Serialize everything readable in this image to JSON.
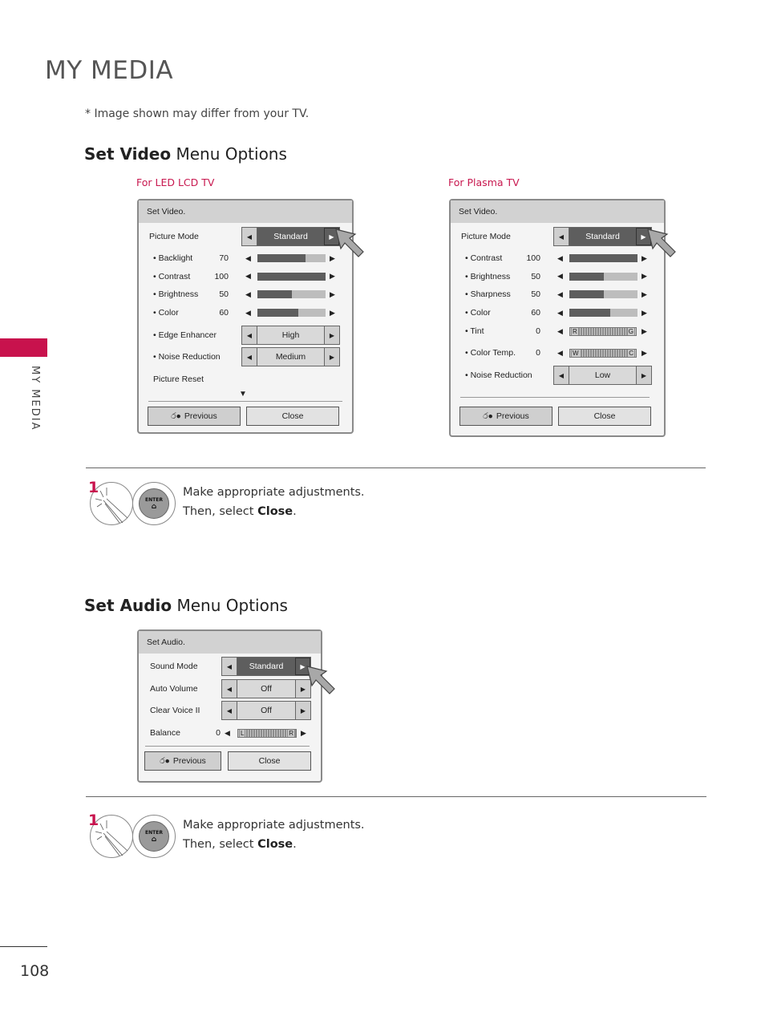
{
  "page": {
    "title": "MY MEDIA",
    "note": "* Image shown may differ from your TV.",
    "side_label": "MY MEDIA",
    "page_number": "108",
    "accent_color": "#c8124d"
  },
  "video_section": {
    "title_bold": "Set Video",
    "title_rest": " Menu Options",
    "led": {
      "caption": "For LED LCD TV",
      "header": "Set Video.",
      "picture_mode_label": "Picture Mode",
      "picture_mode_value": "Standard",
      "sliders": [
        {
          "label": "• Backlight",
          "value": "70",
          "percent": 70
        },
        {
          "label": "• Contrast",
          "value": "100",
          "percent": 100
        },
        {
          "label": "• Brightness",
          "value": "50",
          "percent": 50
        },
        {
          "label": "• Color",
          "value": "60",
          "percent": 60
        }
      ],
      "selectors": [
        {
          "label": "• Edge Enhancer",
          "value": "High"
        },
        {
          "label": "• Noise Reduction",
          "value": "Medium"
        }
      ],
      "picture_reset": "Picture Reset",
      "previous": "Previous",
      "close": "Close"
    },
    "plasma": {
      "caption": "For Plasma TV",
      "header": "Set Video.",
      "picture_mode_label": "Picture Mode",
      "picture_mode_value": "Standard",
      "sliders": [
        {
          "label": "• Contrast",
          "value": "100",
          "percent": 100
        },
        {
          "label": "• Brightness",
          "value": "50",
          "percent": 50
        },
        {
          "label": "• Sharpness",
          "value": "50",
          "percent": 50
        },
        {
          "label": "• Color",
          "value": "60",
          "percent": 60
        }
      ],
      "balance_sliders": [
        {
          "label": "• Tint",
          "value": "0",
          "left": "R",
          "right": "G"
        },
        {
          "label": "• Color Temp.",
          "value": "0",
          "left": "W",
          "right": "C"
        }
      ],
      "selectors": [
        {
          "label": "• Noise Reduction",
          "value": "Low"
        }
      ],
      "previous": "Previous",
      "close": "Close"
    },
    "step": {
      "number": "1",
      "enter_label": "ENTER",
      "line1": "Make appropriate adjustments.",
      "line2_prefix": "Then, select ",
      "line2_bold": "Close",
      "line2_suffix": "."
    }
  },
  "audio_section": {
    "title_bold": "Set Audio",
    "title_rest": " Menu Options",
    "panel": {
      "header": "Set Audio.",
      "selectors": [
        {
          "label": "Sound Mode",
          "value": "Standard"
        },
        {
          "label": "Auto Volume",
          "value": "Off"
        },
        {
          "label": "Clear Voice II",
          "value": "Off"
        }
      ],
      "balance": {
        "label": "Balance",
        "value": "0",
        "left": "L",
        "right": "R"
      },
      "previous": "Previous",
      "close": "Close"
    },
    "step": {
      "number": "1",
      "enter_label": "ENTER",
      "line1": "Make appropriate adjustments.",
      "line2_prefix": "Then, select ",
      "line2_bold": "Close",
      "line2_suffix": "."
    }
  }
}
